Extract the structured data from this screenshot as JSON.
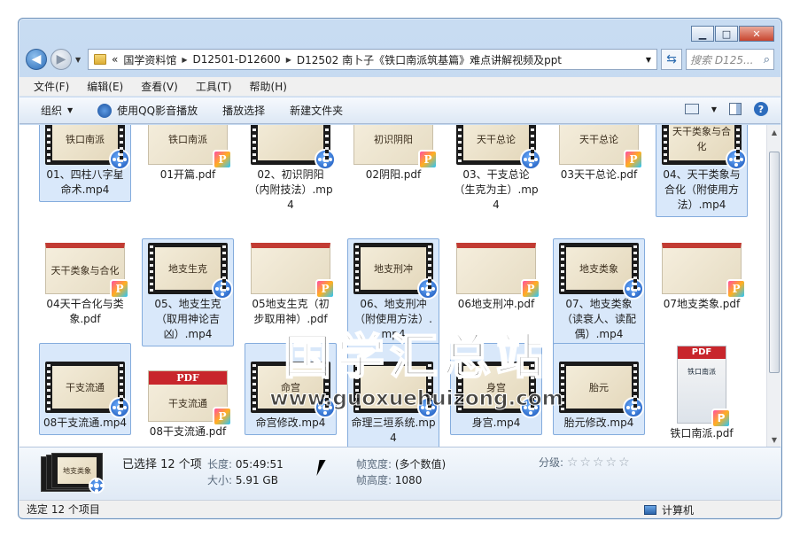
{
  "window": {
    "caption": {
      "minimize": "▁",
      "maximize": "□",
      "close": "✕"
    }
  },
  "nav": {
    "back": "◀",
    "forward": "▶",
    "refresh": "⇆"
  },
  "address": {
    "overflow": "«",
    "crumbs": [
      "国学资料馆",
      "D12501-D12600",
      "D12502 南卜子《铁口南派筑基篇》难点讲解视频及ppt"
    ]
  },
  "search": {
    "placeholder": "搜索 D125..."
  },
  "menu": [
    "文件(F)",
    "编辑(E)",
    "查看(V)",
    "工具(T)",
    "帮助(H)"
  ],
  "toolbar": {
    "organize": "组织",
    "qq_play": "使用QQ影音播放",
    "play_selection": "播放选择",
    "new_folder": "新建文件夹"
  },
  "files": [
    {
      "label": "01、四柱八字星命术.mp4",
      "thumb_text": "铁口南派",
      "selected": true
    },
    {
      "label": "01开篇.pdf",
      "thumb_text": "铁口南派",
      "selected": false
    },
    {
      "label": "02、初识阴阳（内附技法）.mp4",
      "thumb_text": "",
      "selected": false
    },
    {
      "label": "02阴阳.pdf",
      "thumb_text": "初识阴阳",
      "selected": false
    },
    {
      "label": "03、干支总论（生克为主）.mp4",
      "thumb_text": "天干总论",
      "selected": false
    },
    {
      "label": "03天干总论.pdf",
      "thumb_text": "天干总论",
      "selected": false
    },
    {
      "label": "04、天干类象与合化（附使用方法）.mp4",
      "thumb_text": "天干类象与合化",
      "selected": true
    },
    {
      "label": "04天干合化与类象.pdf",
      "thumb_text": "天干类象与合化",
      "selected": false
    },
    {
      "label": "05、地支生克（取用神论吉凶）.mp4",
      "thumb_text": "地支生克",
      "selected": true
    },
    {
      "label": "05地支生克（初步取用神）.pdf",
      "thumb_text": "",
      "selected": false
    },
    {
      "label": "06、地支刑冲（附使用方法）.mp4",
      "thumb_text": "地支刑冲",
      "selected": true
    },
    {
      "label": "06地支刑冲.pdf",
      "thumb_text": "",
      "selected": false
    },
    {
      "label": "07、地支类象（读衰人、读配偶）.mp4",
      "thumb_text": "地支类象",
      "selected": true
    },
    {
      "label": "07地支类象.pdf",
      "thumb_text": "",
      "selected": false
    },
    {
      "label": "08干支流通.mp4",
      "thumb_text": "干支流通",
      "selected": true
    },
    {
      "label": "08干支流通.pdf",
      "thumb_text": "干支流通",
      "selected": false
    },
    {
      "label": "命宫修改.mp4",
      "thumb_text": "命宫",
      "selected": true
    },
    {
      "label": "命理三垣系统.mp4",
      "thumb_text": "",
      "selected": true
    },
    {
      "label": "身宫.mp4",
      "thumb_text": "身宫",
      "selected": true
    },
    {
      "label": "胎元修改.mp4",
      "thumb_text": "胎元",
      "selected": true
    },
    {
      "label": "铁口南派.pdf",
      "thumb_text": "铁口南派",
      "selected": false
    }
  ],
  "pdf_banner": "PDF",
  "pdf_badge": "P",
  "watermark": {
    "cn": "国学汇总站",
    "url": "www.guoxuehuizong.com"
  },
  "details": {
    "thumb_text": "地支类象",
    "selected_count": "已选择 12 个项",
    "length_label": "长度:",
    "length_value": "05:49:51",
    "size_label": "大小:",
    "size_value": "5.91 GB",
    "frame_width_label": "帧宽度:",
    "frame_width_value": "(多个数值)",
    "frame_height_label": "帧高度:",
    "frame_height_value": "1080",
    "rating_label": "分级:",
    "rating_stars": "☆☆☆☆☆"
  },
  "status": {
    "left": "选定 12 个项目",
    "right": "计算机"
  }
}
